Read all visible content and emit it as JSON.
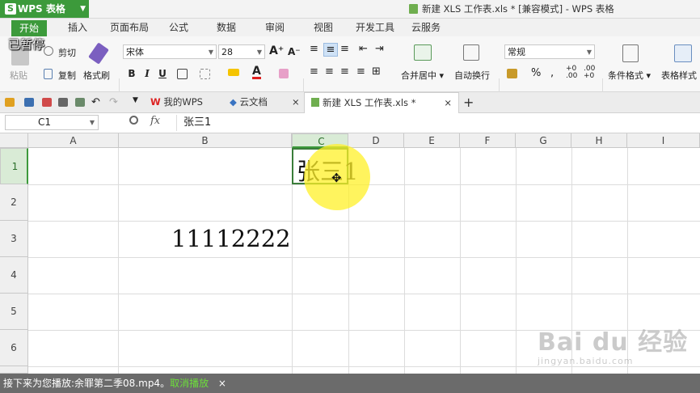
{
  "app": {
    "name": "WPS 表格",
    "logo_letter": "S"
  },
  "window": {
    "title": "新建 XLS 工作表.xls * [兼容模式] - WPS 表格"
  },
  "overlay": {
    "paused_text": "已暂停"
  },
  "menu": {
    "items": [
      "开始",
      "插入",
      "页面布局",
      "公式",
      "数据",
      "审阅",
      "视图",
      "开发工具",
      "云服务"
    ],
    "active": "开始"
  },
  "ribbon": {
    "paste": "粘贴",
    "cut": "剪切",
    "copy": "复制",
    "format_painter": "格式刷",
    "font_name": "宋体",
    "font_size": "28",
    "bold": "B",
    "italic": "I",
    "underline": "U",
    "merge_center": "合并居中",
    "wrap_text": "自动换行",
    "number_format": "常规",
    "percent": "%",
    "conditional_format": "条件格式",
    "table_style": "表格样式"
  },
  "tabs": [
    {
      "label": "我的WPS",
      "active": false
    },
    {
      "label": "云文档",
      "active": false
    },
    {
      "label": "新建 XLS 工作表.xls *",
      "active": true
    }
  ],
  "formula_bar": {
    "name_box": "C1",
    "fx": "fx",
    "content": "张三1"
  },
  "sheet": {
    "columns": [
      "A",
      "B",
      "C",
      "D",
      "E",
      "F",
      "G",
      "H",
      "I"
    ],
    "rows": [
      "1",
      "2",
      "3",
      "4",
      "5",
      "6"
    ],
    "selected_column": "C",
    "selected_row": "1",
    "cells": {
      "C1": "张三1",
      "B3": "11112222"
    }
  },
  "bottom_bar": {
    "text": "接下来为您播放:余罪第二季08.mp4。",
    "cancel_link": "取消播放",
    "close": "×"
  },
  "watermark": {
    "main": "Bai du 经验",
    "sub": "jingyan.baidu.com"
  },
  "colors": {
    "accent": "#3c9a3b",
    "highlight": "#fff028"
  }
}
